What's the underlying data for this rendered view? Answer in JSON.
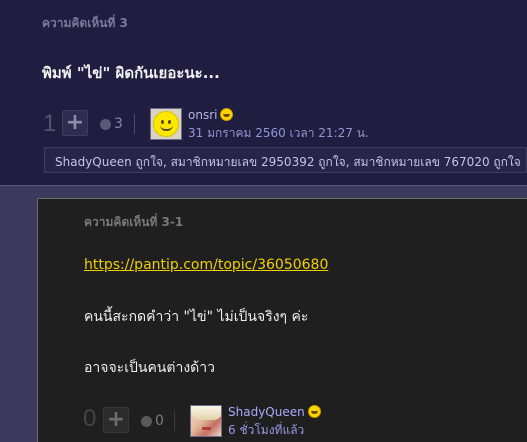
{
  "comment": {
    "number_label": "ความคิดเห็นที่ 3",
    "body": "พิมพ์ \"ไข่\" ผิดกันเยอะนะ...",
    "votes": "1",
    "emotion_count": "3",
    "author": "onsri",
    "timestamp": "31 มกราคม 2560 เวลา 21:27 น.",
    "likes_text": "ShadyQueen ถูกใจ, สมาชิกหมายเลข 2950392 ถูกใจ, สมาชิกหมายเลข 767020 ถูกใจ"
  },
  "reply": {
    "number_label": "ความคิดเห็นที่ 3-1",
    "link": "https://pantip.com/topic/36050680",
    "line1": "คนนี้สะกดคำว่า \"ไข่\" ไม่เป็นจริงๆ ค่ะ",
    "line2": "อาจจะเป็นคนต่างด้าว",
    "votes": "0",
    "emotion_count": "0",
    "author": "ShadyQueen",
    "timestamp": "6 ชั่วโมงที่แล้ว"
  },
  "icons": {
    "plus": "plus-icon",
    "emotion": "emotion-icon",
    "badge": "smiley-badge-icon"
  }
}
